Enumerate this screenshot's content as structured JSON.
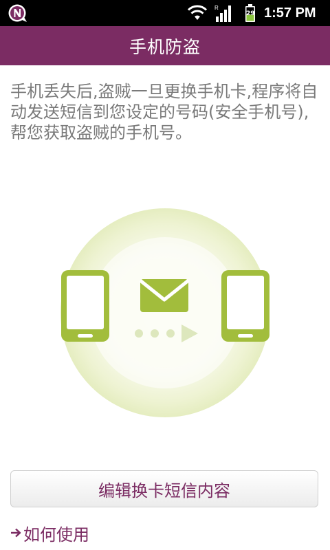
{
  "status_bar": {
    "app_icon": "n-notification-icon",
    "wifi_icon": "wifi-icon",
    "signal_icon": "cell-signal-icon",
    "roaming_indicator": "R",
    "battery_icon": "battery-charging-icon",
    "battery_level": "29",
    "time": "1:57 PM"
  },
  "header": {
    "title": "手机防盗",
    "background_color": "#7b2c63"
  },
  "main": {
    "description": "手机丢失后,盗贼一旦更换手机卡,程序将自动发送短信到您设定的号码(安全手机号),帮您获取盗贼的手机号。",
    "illustration": {
      "left_icon": "phone-icon",
      "center_icon": "envelope-icon",
      "right_icon": "phone-icon",
      "accent_color": "#a2bd3c"
    }
  },
  "actions": {
    "edit_button_label": "编辑换卡短信内容",
    "help_link_label": "如何使用",
    "help_link_icon": "arrow-right-icon",
    "accent_color": "#7b2c63"
  }
}
